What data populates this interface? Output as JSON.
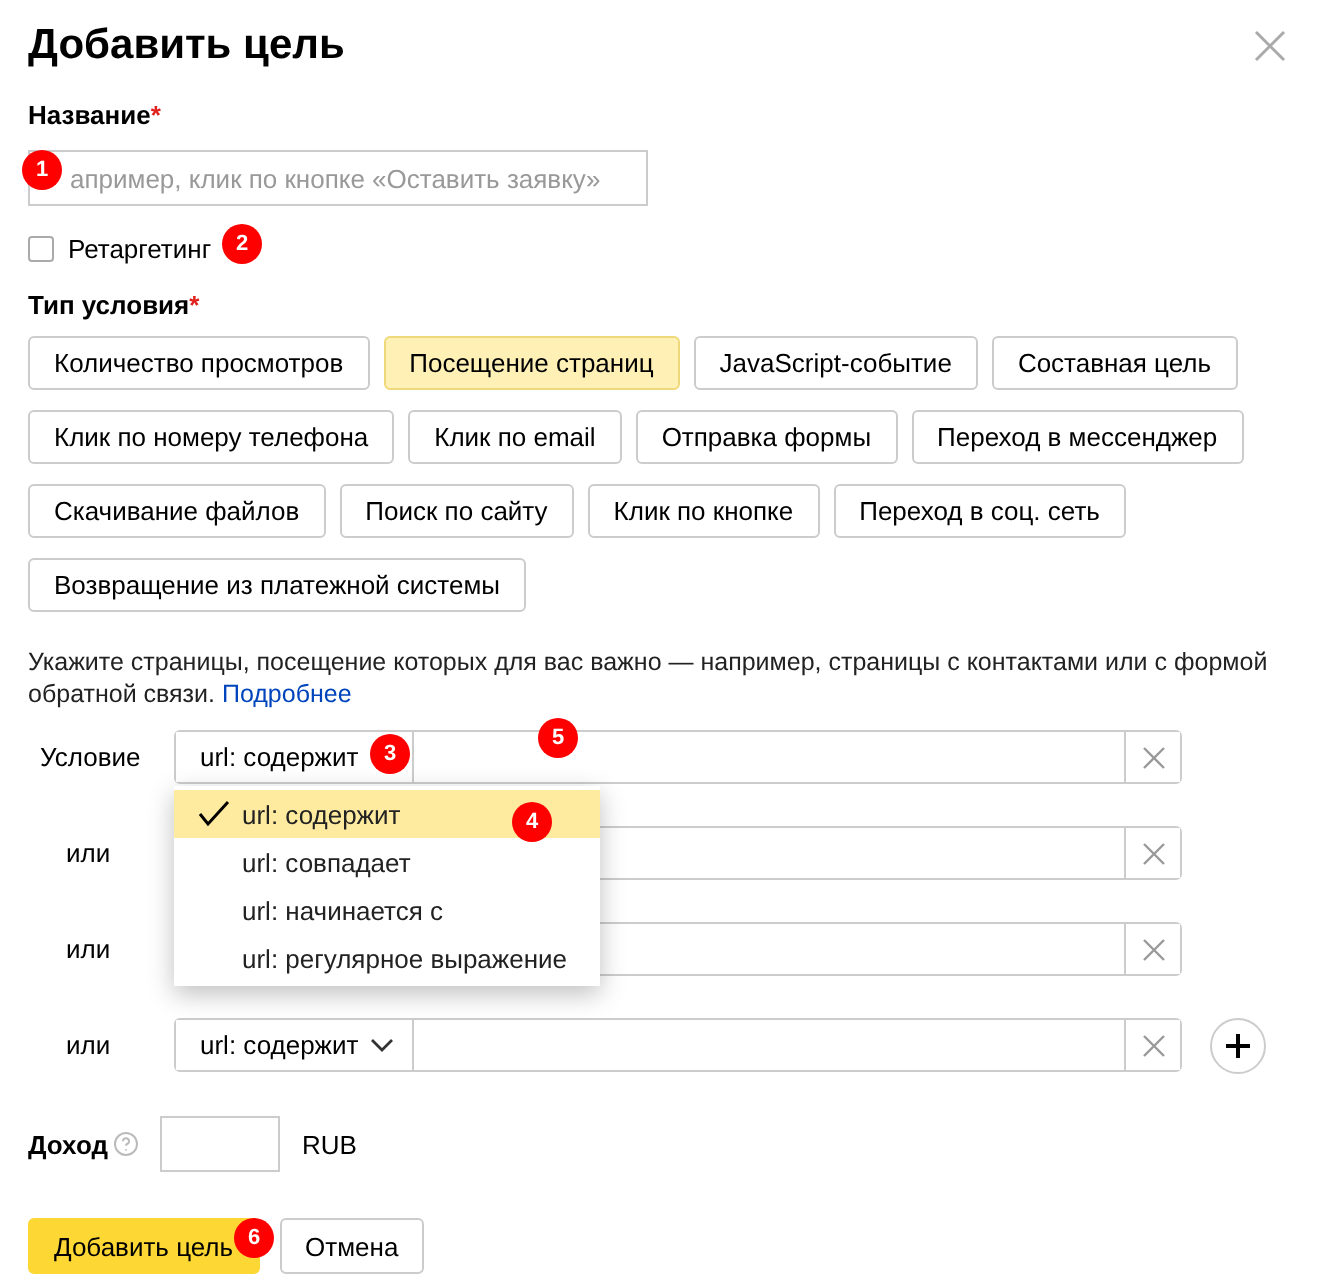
{
  "dialog": {
    "title": "Добавить цель"
  },
  "name_field": {
    "label": "Название",
    "required_mark": "*",
    "placeholder": "апример, клик по кнопке «Оставить заявку»"
  },
  "retargeting": {
    "label": "Ретаргетинг",
    "checked": false
  },
  "condition_type": {
    "label": "Тип условия",
    "required_mark": "*",
    "rows": [
      [
        {
          "label": "Количество просмотров",
          "selected": false
        },
        {
          "label": "Посещение страниц",
          "selected": true
        },
        {
          "label": "JavaScript-событие",
          "selected": false
        },
        {
          "label": "Составная цель",
          "selected": false
        }
      ],
      [
        {
          "label": "Клик по номеру телефона",
          "selected": false
        },
        {
          "label": "Клик по email",
          "selected": false
        },
        {
          "label": "Отправка формы",
          "selected": false
        },
        {
          "label": "Переход в мессенджер",
          "selected": false
        }
      ],
      [
        {
          "label": "Скачивание файлов",
          "selected": false
        },
        {
          "label": "Поиск по сайту",
          "selected": false
        },
        {
          "label": "Клик по кнопке",
          "selected": false
        },
        {
          "label": "Переход в соц. сеть",
          "selected": false
        }
      ],
      [
        {
          "label": "Возвращение из платежной системы",
          "selected": false
        }
      ]
    ]
  },
  "description": {
    "text": "Укажите страницы, посещение которых для вас важно — например, страницы с контактами или с формой обратной связи.",
    "link": "Подробнее"
  },
  "conditions": [
    {
      "label": "Условие",
      "select": "url: содержит",
      "add_button": false
    },
    {
      "label": "или",
      "add_button": false
    },
    {
      "label": "или",
      "add_button": false
    },
    {
      "label": "или",
      "select": "url: содержит",
      "add_button": true
    }
  ],
  "dropdown": {
    "options": [
      {
        "label": "url: содержит",
        "selected": true
      },
      {
        "label": "url: совпадает",
        "selected": false
      },
      {
        "label": "url: начинается с",
        "selected": false
      },
      {
        "label": "url: регулярное выражение",
        "selected": false
      }
    ]
  },
  "income": {
    "label": "Доход",
    "currency": "RUB"
  },
  "buttons": [
    {
      "label": "Добавить цель",
      "kind": "primary"
    },
    {
      "label": "Отмена",
      "kind": "secondary"
    }
  ],
  "annotations": [
    {
      "label": "1"
    },
    {
      "label": "2"
    },
    {
      "label": "3"
    },
    {
      "label": "4"
    },
    {
      "label": "5"
    },
    {
      "label": "6"
    }
  ]
}
